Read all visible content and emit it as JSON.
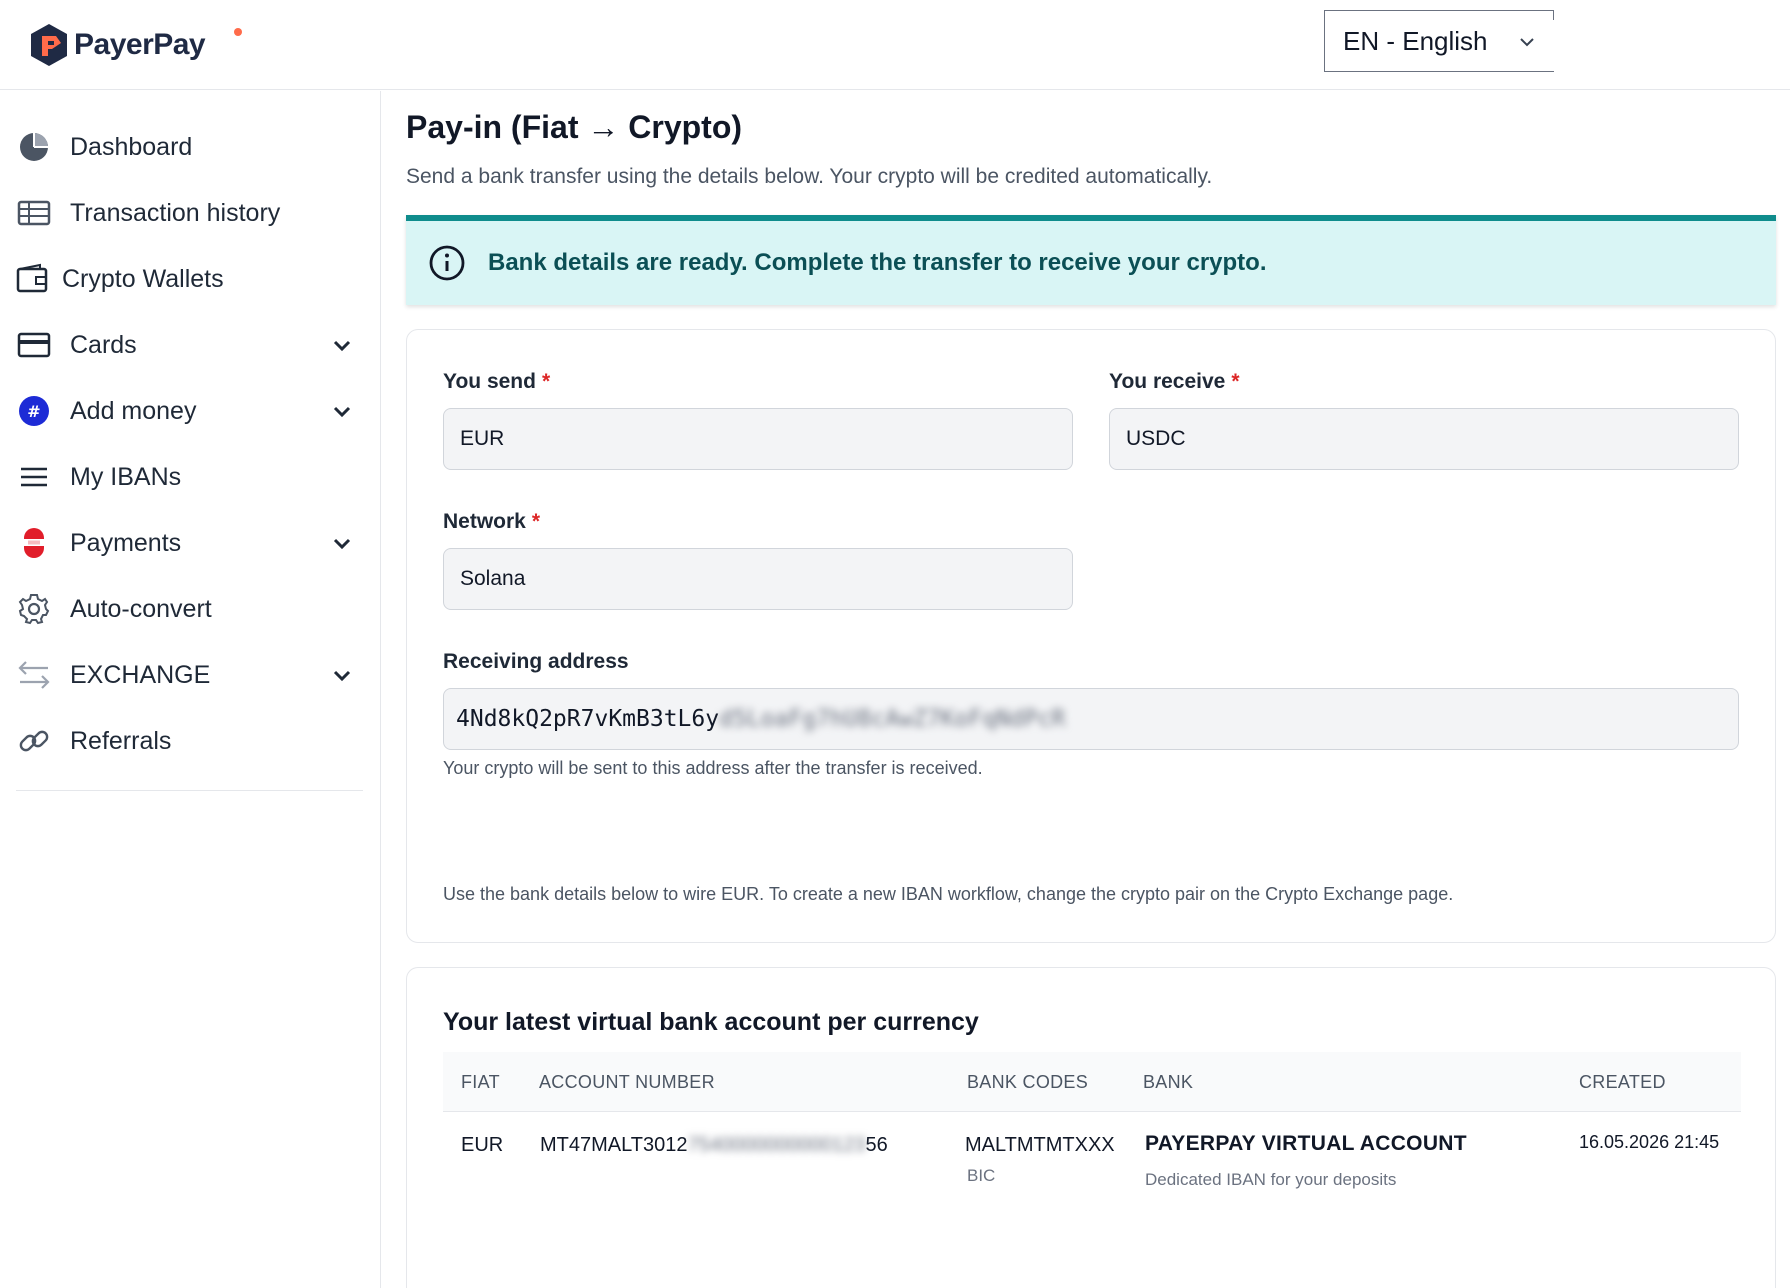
{
  "header": {
    "brand": "PayerPay",
    "language": "EN - English"
  },
  "sidebar": {
    "items": [
      {
        "label": "Dashboard",
        "icon": "pie-chart-icon"
      },
      {
        "label": "Transaction history",
        "icon": "table-icon"
      },
      {
        "label": "Crypto Wallets",
        "icon": "wallet-icon"
      },
      {
        "label": "Cards",
        "icon": "card-icon"
      },
      {
        "label": "Add money",
        "icon": "add-money-icon"
      },
      {
        "label": "My IBANs",
        "icon": "menu-icon"
      },
      {
        "label": "Payments",
        "icon": "payments-icon"
      },
      {
        "label": "Auto-convert",
        "icon": "gear-icon"
      },
      {
        "label": "EXCHANGE",
        "icon": "exchange-arrows-icon"
      },
      {
        "label": "Referrals",
        "icon": "link-icon"
      }
    ]
  },
  "page": {
    "title": "Pay-in (Fiat → Crypto)",
    "subtitle": "Send a bank transfer using the details below. Your crypto will be credited automatically."
  },
  "alert": {
    "text": "Bank details are ready. Complete the transfer to receive your crypto."
  },
  "form": {
    "send_label": "You send",
    "send_value": "EUR",
    "receive_label": "You receive",
    "receive_value": "USDC",
    "network_label": "Network",
    "network_value": "Solana",
    "address_label": "Receiving address",
    "address_visible": "4Nd8kQ2pR7vKmB3tL6y",
    "address_hidden": "d5LoaFg7hU8cAwZ7KoFqNdPcR",
    "address_help": "Your crypto will be sent to this address after the transfer is received.",
    "note": "Use the bank details below to wire EUR. To create a new IBAN workflow, change the crypto pair on the Crypto Exchange page.",
    "required_mark": "*"
  },
  "table": {
    "title": "Your latest virtual bank account per currency",
    "headers": {
      "fiat": "FIAT",
      "account": "ACCOUNT NUMBER",
      "codes": "BANK CODES",
      "bank": "BANK",
      "created": "CREATED"
    },
    "rows": [
      {
        "fiat": "EUR",
        "account_start": "MT47MALT3012",
        "account_hidden": "7540000000000123",
        "account_end": "56",
        "code": "MALTMTMTXXX",
        "code_type": "BIC",
        "bank": "PAYERPAY VIRTUAL ACCOUNT",
        "bank_desc": "Dedicated IBAN for your deposits",
        "created": "16.05.2026 21:45"
      }
    ]
  },
  "colors": {
    "accent_teal": "#0f8c8c",
    "alert_bg": "#d9f5f5",
    "alert_text": "#0b4f55",
    "required": "#dc2626",
    "brand_orange": "#ff6b4a",
    "brand_navy": "#1f2a44"
  }
}
